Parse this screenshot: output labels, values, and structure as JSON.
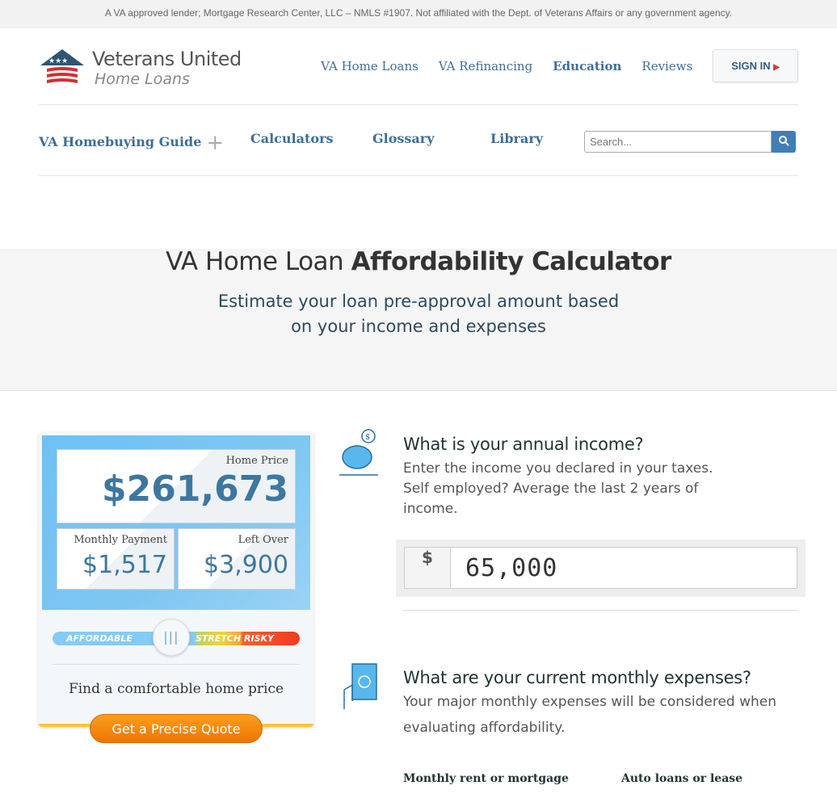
{
  "topbar": "A VA approved lender; Mortgage Research Center, LLC – NMLS #1907. Not affiliated with the Dept. of Veterans Affairs or any government agency.",
  "logo": {
    "line1": "Veterans United",
    "line2": "Home Loans"
  },
  "nav": [
    "VA Home Loans",
    "VA Refinancing",
    "Education",
    "Reviews"
  ],
  "signin": "SIGN IN",
  "subnav": [
    "VA Homebuying Guide",
    "Calculators",
    "Glossary",
    "Library"
  ],
  "search": {
    "placeholder": "Search..."
  },
  "hero": {
    "title_a": "VA Home Loan ",
    "title_b": "Affordability Calculator",
    "sub1": "Estimate your loan pre-approval amount based",
    "sub2": "on your income and expenses"
  },
  "card": {
    "home_price_label": "Home Price",
    "home_price": "$261,673",
    "monthly_label": "Monthly Payment",
    "monthly": "$1,517",
    "left_label": "Left Over",
    "left": "$3,900",
    "zones": [
      "AFFORDABLE",
      "STRETCH",
      "RISKY"
    ],
    "slider_position": 0.48,
    "find": "Find a comfortable home price",
    "quote": "Get a Precise Quote"
  },
  "income": {
    "title": "What is your annual income?",
    "desc": "Enter the income you declared in your taxes. Self employed? Average the last 2 years of income.",
    "currency": "$",
    "value": "65,000"
  },
  "expenses": {
    "title": "What are your current monthly expenses?",
    "desc": "Your major monthly expenses will be considered when evaluating affordability.",
    "fields": [
      "Monthly rent or mortgage",
      "Auto loans or lease"
    ]
  },
  "colors": {
    "brand": "#3f6f95",
    "accent": "#ef7300",
    "card_blue": "#6ec0f4"
  }
}
